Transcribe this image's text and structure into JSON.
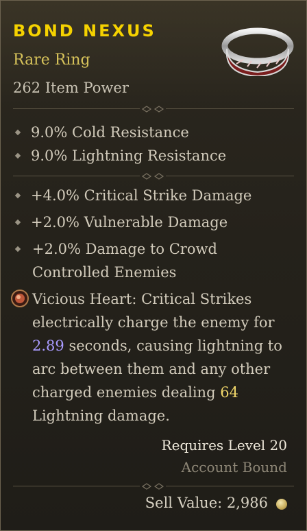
{
  "item": {
    "name": "BOND NEXUS",
    "rarity": "Rare Ring",
    "item_power": "262 Item Power"
  },
  "implicits": [
    "9.0% Cold Resistance",
    "9.0% Lightning Resistance"
  ],
  "affixes": [
    "+4.0% Critical Strike Damage",
    "+2.0% Vulnerable Damage",
    "+2.0% Damage to Crowd Controlled Enemies"
  ],
  "aspect": {
    "part1": "Vicious Heart: Critical Strikes electrically charge the enemy for ",
    "duration": "2.89",
    "part2": " seconds, causing lightning to arc between them and any other charged enemies dealing ",
    "damage": "64",
    "part3": " Lightning damage."
  },
  "requirements": {
    "level": "Requires Level 20",
    "binding": "Account Bound"
  },
  "sell": {
    "label": "Sell Value: 2,986"
  },
  "icons": {
    "item": "ring-icon",
    "aspect": "aspect-orb-icon",
    "currency": "gold-coin-icon"
  },
  "colors": {
    "title": "#f5d200",
    "rarity": "#d6c25a",
    "duration_value": "#a99bff",
    "damage_value": "#f0d66a"
  }
}
